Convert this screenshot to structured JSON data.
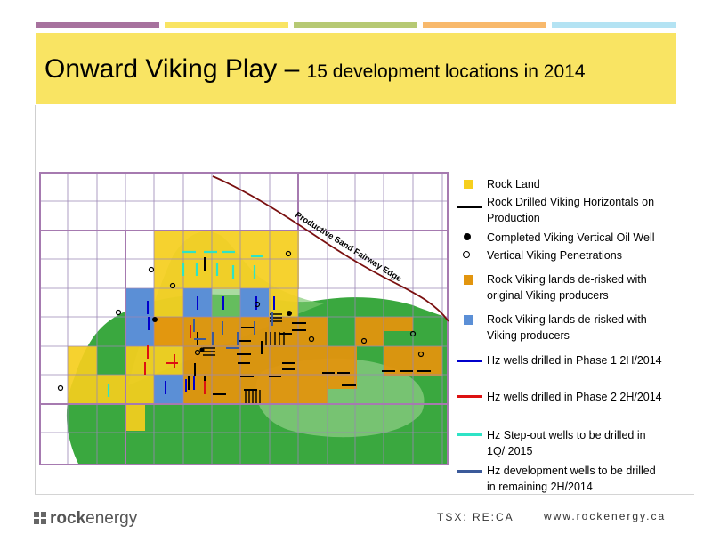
{
  "colors": {
    "bar1": "#a7729e",
    "bar2": "#f9e463",
    "bar3": "#b6c974",
    "bar4": "#f8b96c",
    "bar5": "#b4e3f3",
    "title_bg": "#f9e463",
    "rock_land": "#f6cf1e",
    "derisk_orig": "#e2950e",
    "derisk_new": "#5b8fd6",
    "sand": "#3aa83f",
    "phase1": "#0000cc",
    "phase2": "#dd1111",
    "stepout": "#2ee3c6",
    "dev": "#3b5a9a"
  },
  "slide": {
    "title_main": "Onward Viking Play – ",
    "title_sub": "15 development locations in 2014"
  },
  "map": {
    "fairway_label": "Productive Sand Fairway Edge"
  },
  "legend": {
    "rock_land": "Rock Land",
    "rock_drilled_1": "Rock Drilled Viking Horizontals on",
    "rock_drilled_2": "Production",
    "completed": "Completed Viking Vertical Oil Well",
    "vertical": "Vertical Viking Penetrations",
    "derisk_orig_1": "Rock Viking lands de-risked with",
    "derisk_orig_2": "original Viking producers",
    "derisk_new_1": "Rock Viking lands de-risked with",
    "derisk_new_2": "Viking producers",
    "phase1": "Hz wells drilled in Phase 1 2H/2014",
    "phase2": "Hz wells drilled in Phase 2 2H/2014",
    "stepout_1": "Hz Step-out wells to be drilled  in",
    "stepout_2": "1Q/ 2015",
    "dev_1": "Hz development wells to be drilled",
    "dev_2": "in remaining 2H/2014"
  },
  "footer": {
    "logo_rock": "rock",
    "logo_energy": "energy",
    "ticker": "TSX: RE:CA",
    "website": "www.rockenergy.ca"
  }
}
